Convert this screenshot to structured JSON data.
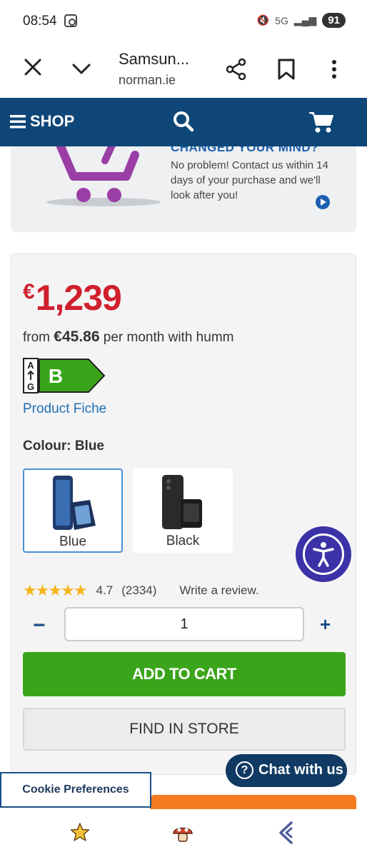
{
  "status_bar": {
    "time": "08:54",
    "network": "5G",
    "battery": "91"
  },
  "browser": {
    "title": "Samsun...",
    "url": "norman.ie"
  },
  "shop_nav": {
    "label": "SHOP"
  },
  "promo": {
    "heading": "CHANGED YOUR MIND?",
    "text": "No problem! Contact us within 14 days of your purchase and we'll look after you!"
  },
  "product": {
    "currency": "€",
    "price": "1,239",
    "finance_prefix": "from ",
    "finance_amount": "€45.86",
    "finance_suffix": " per month with humm",
    "energy": {
      "scale_top": "A",
      "scale_bottom": "G",
      "rating": "B",
      "color": "#3aa51a"
    },
    "product_fiche_link": "Product Fiche",
    "colour_label": "Colour: Blue",
    "colours": [
      {
        "name": "Blue",
        "selected": true
      },
      {
        "name": "Black",
        "selected": false
      }
    ],
    "rating": {
      "stars": "★★★★★",
      "value": "4.7",
      "count": "(2334)",
      "write_review": "Write a review."
    },
    "quantity": "1",
    "add_to_cart": "ADD TO CART",
    "find_in_store": "FIND IN STORE"
  },
  "chat": {
    "label": "Chat with us"
  },
  "cookie": {
    "label": "Cookie Preferences"
  },
  "colors": {
    "brand_blue": "#0e4678",
    "price_red": "#d0202d",
    "cta_green": "#3aa51a",
    "accessibility_purple": "#3b32a8",
    "accent_orange": "#f47b20"
  }
}
